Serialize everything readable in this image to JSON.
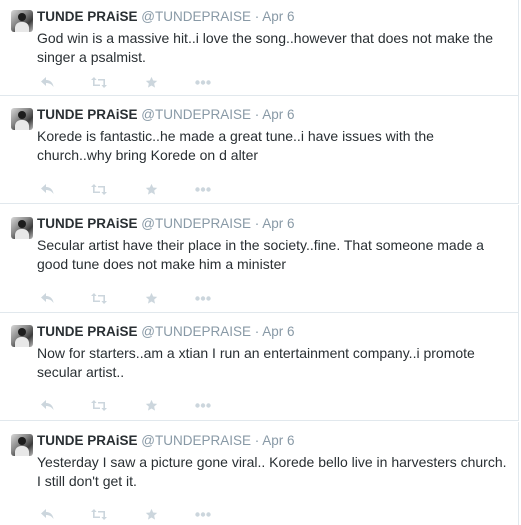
{
  "tweets": [
    {
      "fullname": "TUNDE PRAiSE",
      "username": "@TUNDEPRAISE",
      "separator": "·",
      "time": "Apr 6",
      "text": "God win is a massive hit..i love the song..however that does not make the singer a psalmist."
    },
    {
      "fullname": "TUNDE PRAiSE",
      "username": "@TUNDEPRAISE",
      "separator": "·",
      "time": "Apr 6",
      "text": "Korede is fantastic..he made a great tune..i have issues with the church..why bring Korede on d alter"
    },
    {
      "fullname": "TUNDE PRAiSE",
      "username": "@TUNDEPRAISE",
      "separator": "·",
      "time": "Apr 6",
      "text": "Secular artist have their place in the society..fine. That someone made a good tune does not make him a minister"
    },
    {
      "fullname": "TUNDE PRAiSE",
      "username": "@TUNDEPRAISE",
      "separator": "·",
      "time": "Apr 6",
      "text": "Now for starters..am a xtian I run an entertainment company..i promote secular artist.."
    },
    {
      "fullname": "TUNDE PRAiSE",
      "username": "@TUNDEPRAISE",
      "separator": "·",
      "time": "Apr 6",
      "text": "Yesterday I saw a picture gone viral.. Korede bello live in harvesters church. I still don't get it."
    }
  ],
  "icons": {
    "reply": "reply-icon",
    "retweet": "retweet-icon",
    "favorite": "star-icon",
    "more": "more-icon"
  },
  "colors": {
    "text": "#292f33",
    "meta": "#8899a6",
    "action_icon": "#ccd6dd",
    "divider": "#e1e8ed"
  }
}
